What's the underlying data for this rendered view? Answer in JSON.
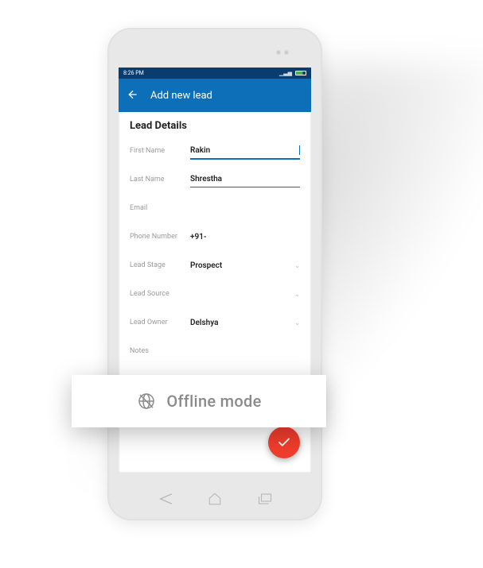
{
  "statusbar": {
    "time": "8:26 PM"
  },
  "appbar": {
    "title": "Add new lead"
  },
  "section": {
    "title": "Lead Details"
  },
  "form": {
    "first_name": {
      "label": "First Name",
      "value": "Rakin"
    },
    "last_name": {
      "label": "Last Name",
      "value": "Shrestha"
    },
    "email": {
      "label": "Email",
      "value": ""
    },
    "phone": {
      "label": "Phone Number",
      "value": "+91-"
    },
    "lead_stage": {
      "label": "Lead Stage",
      "value": "Prospect"
    },
    "lead_source": {
      "label": "Lead Source",
      "value": ""
    },
    "lead_owner": {
      "label": "Lead Owner",
      "value": "Delshya"
    },
    "notes": {
      "label": "Notes"
    }
  },
  "offline": {
    "label": "Offline mode"
  },
  "colors": {
    "accent": "#0d6fb8",
    "statusbar": "#0a3d6e",
    "fab": "#f13d2c"
  }
}
